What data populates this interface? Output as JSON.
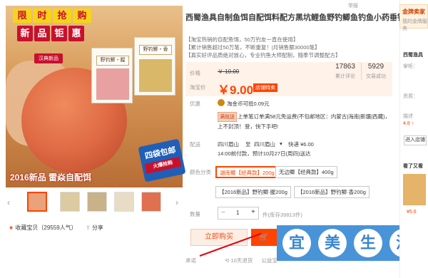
{
  "gallery": {
    "promo_chars": [
      "限",
      "时",
      "抢",
      "购",
      "新",
      "品",
      "钜",
      "惠"
    ],
    "brand_badge": "汉典新品",
    "bag1_label": "野钓鲫・腥",
    "bag2_label": "野钓鲫・香",
    "caption": "2016新品 雷焱自配饵",
    "stamp_main": "四袋包邮",
    "stamp_sub": "火爆抢购",
    "thumbs_count": 5,
    "fav_label": "收藏宝贝（29559人气）",
    "share_label": "分享"
  },
  "product": {
    "title": "西蜀渔具自制鱼饵自配饵料配方黑坑鲤鱼野钓鲫鱼钓鱼小药垂钓用品",
    "report": "举报",
    "bullets": [
      "【淘宝热销的自配鱼饵，50万钓友一直在使用】",
      "【累计销售超过50万笔，不断重复！|月销售额30000笔】",
      "【真实好评品质绝对放心，专业钓鱼大师配制，随季节调整配方】"
    ]
  },
  "price": {
    "label_orig": "价格",
    "orig": "￥ 10.00",
    "label_now": "淘宝价",
    "now": "￥9.00",
    "tag": "店铺特卖",
    "reviews_count": "17863",
    "reviews_label": "累计评论",
    "sales_count": "5929",
    "sales_label": "交易成功"
  },
  "benefits": {
    "label": "优惠",
    "text": "淘金币可抵0.09元",
    "promo_flag": "满就送",
    "promo_text": "上单笔订单满58元免运费(不包邮地区：内蒙古|海南|新疆|西藏)，",
    "promo_text2": "上不封顶！",
    "promo_link": "登，快下手吧!"
  },
  "shipping": {
    "label": "配送",
    "from": "四川眉山",
    "to_word": "至",
    "to": "四川眉山",
    "express": "快递 ¥6.00",
    "eta": "14:00前付款，预计10月27日(周四)送达"
  },
  "options": {
    "label": "颜色分类",
    "items": [
      "湖库鲫【经典款】200g",
      "无边鲫【经典款】400g",
      "【2016新品】野钓鲫·腥200g",
      "【2016新品】野钓鲫·香200g"
    ]
  },
  "quantity": {
    "label": "数量",
    "minus": "−",
    "value": "1",
    "plus": "+",
    "stock": "件(库存39813件)"
  },
  "actions": {
    "buy": "立即购买",
    "cart_icon": "cart-icon"
  },
  "watermark": {
    "chars": [
      "宜",
      "美",
      "生",
      "活"
    ]
  },
  "footer": {
    "label": "承诺",
    "text1": "10天退货",
    "text2": "公益宝"
  },
  "sidebar": {
    "shop_name": "金牌卖家",
    "shop_sub": "我的金牌服务",
    "store": "西蜀渔具",
    "rows": [
      "掌柜：",
      "资质：",
      "描述",
      "4.8 ↑"
    ],
    "enter": "进入店铺",
    "tip": "看了又看",
    "p1": "¥5.6"
  },
  "colors": {
    "accent": "#f40",
    "price_bg": "#fff2e8",
    "watermark": "#3a8ad6"
  }
}
